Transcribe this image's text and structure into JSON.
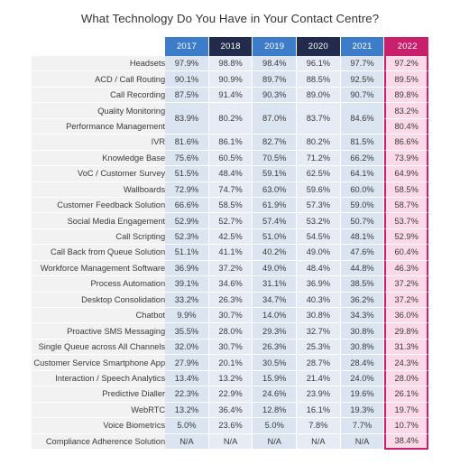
{
  "title": "What Technology Do You Have in Your Contact Centre?",
  "colors": {
    "header_blue": "#3d7cc9",
    "header_navy": "#232b4d",
    "header_magenta": "#c9206e",
    "cell_blue_a": "#dbe5f1",
    "cell_blue_b": "#e7ebf5",
    "cell_pink": "#fbd9e7",
    "label_bg": "#f2f2f2",
    "text": "#3a3a3a"
  },
  "chart_data": {
    "type": "table",
    "title": "What Technology Do You Have in Your Contact Centre?",
    "xlabel": "",
    "ylabel": "",
    "categories": [
      "2017",
      "2018",
      "2019",
      "2020",
      "2021",
      "2022"
    ],
    "row_label_header": "",
    "rows": [
      {
        "label": "Headsets",
        "values": [
          "97.9%",
          "98.8%",
          "98.4%",
          "96.1%",
          "97.7%",
          "97.2%"
        ]
      },
      {
        "label": "ACD / Call Routing",
        "values": [
          "90.1%",
          "90.9%",
          "89.7%",
          "88.5%",
          "92.5%",
          "89.5%"
        ]
      },
      {
        "label": "Call Recording",
        "values": [
          "87.5%",
          "91.4%",
          "90.3%",
          "89.0%",
          "90.7%",
          "89.8%"
        ]
      },
      {
        "label": "Quality Monitoring",
        "values": [
          "83.9%",
          "80.2%",
          "87.0%",
          "83.7%",
          "84.6%",
          "83.2%"
        ],
        "merged_with_next": true
      },
      {
        "label": "Performance Management",
        "values": [
          "",
          "",
          "",
          "",
          "",
          "80.4%"
        ],
        "merged_continuation": true
      },
      {
        "label": "IVR",
        "values": [
          "81.6%",
          "86.1%",
          "82.7%",
          "80.2%",
          "81.5%",
          "86.6%"
        ]
      },
      {
        "label": "Knowledge Base",
        "values": [
          "75.6%",
          "60.5%",
          "70.5%",
          "71.2%",
          "66.2%",
          "73.9%"
        ]
      },
      {
        "label": "VoC / Customer Survey",
        "values": [
          "51.5%",
          "48.4%",
          "59.1%",
          "62.5%",
          "64.1%",
          "64.9%"
        ]
      },
      {
        "label": "Wallboards",
        "values": [
          "72.9%",
          "74.7%",
          "63.0%",
          "59.6%",
          "60.0%",
          "58.5%"
        ]
      },
      {
        "label": "Customer Feedback Solution",
        "values": [
          "66.6%",
          "58.5%",
          "61.9%",
          "57.3%",
          "59.0%",
          "58.7%"
        ]
      },
      {
        "label": "Social Media Engagement",
        "values": [
          "52.9%",
          "52.7%",
          "57.4%",
          "53.2%",
          "50.7%",
          "53.7%"
        ]
      },
      {
        "label": "Call Scripting",
        "values": [
          "52.3%",
          "42.5%",
          "51.0%",
          "54.5%",
          "48.1%",
          "52.9%"
        ]
      },
      {
        "label": "Call Back from Queue Solution",
        "values": [
          "51.1%",
          "41.1%",
          "40.2%",
          "49.0%",
          "47.6%",
          "60.4%"
        ]
      },
      {
        "label": "Workforce Management Software",
        "values": [
          "36.9%",
          "37.2%",
          "49.0%",
          "48.4%",
          "44.8%",
          "46.3%"
        ]
      },
      {
        "label": "Process Automation",
        "values": [
          "39.1%",
          "34.6%",
          "31.1%",
          "36.9%",
          "38.5%",
          "37.2%"
        ]
      },
      {
        "label": "Desktop Consolidation",
        "values": [
          "33.2%",
          "26.3%",
          "34.7%",
          "40.3%",
          "36.2%",
          "37.2%"
        ]
      },
      {
        "label": "Chatbot",
        "values": [
          "9.9%",
          "30.7%",
          "14.0%",
          "30.8%",
          "34.3%",
          "36.0%"
        ]
      },
      {
        "label": "Proactive SMS Messaging",
        "values": [
          "35.5%",
          "28.0%",
          "29.3%",
          "32.7%",
          "30.8%",
          "29.8%"
        ]
      },
      {
        "label": "Single Queue across All Channels",
        "values": [
          "32.0%",
          "30.7%",
          "26.3%",
          "25.3%",
          "30.8%",
          "31.3%"
        ]
      },
      {
        "label": "Customer Service Smartphone App",
        "values": [
          "27.9%",
          "20.1%",
          "30.5%",
          "28.7%",
          "28.4%",
          "24.3%"
        ]
      },
      {
        "label": "Interaction / Speech Analytics",
        "values": [
          "13.4%",
          "13.2%",
          "15.9%",
          "21.4%",
          "24.0%",
          "28.0%"
        ]
      },
      {
        "label": "Predictive Dialler",
        "values": [
          "22.3%",
          "22.9%",
          "24.6%",
          "23.9%",
          "19.6%",
          "26.1%"
        ]
      },
      {
        "label": "WebRTC",
        "values": [
          "13.2%",
          "36.4%",
          "12.8%",
          "16.1%",
          "19.3%",
          "19.7%"
        ]
      },
      {
        "label": "Voice Biometrics",
        "values": [
          "5.0%",
          "23.6%",
          "5.0%",
          "7.8%",
          "7.7%",
          "10.7%"
        ]
      },
      {
        "label": "Compliance Adherence Solution",
        "values": [
          "N/A",
          "N/A",
          "N/A",
          "N/A",
          "N/A",
          "38.4%"
        ]
      }
    ],
    "notes": "Rows 'Quality Monitoring' and 'Performance Management' share merged cells for 2017-2021 (83.9%, 80.2%, 87.0%, 83.7%, 84.6%); the 2022 column lists them separately as 83.2% and 80.4%. The 2022 column is highlighted with a magenta border."
  }
}
